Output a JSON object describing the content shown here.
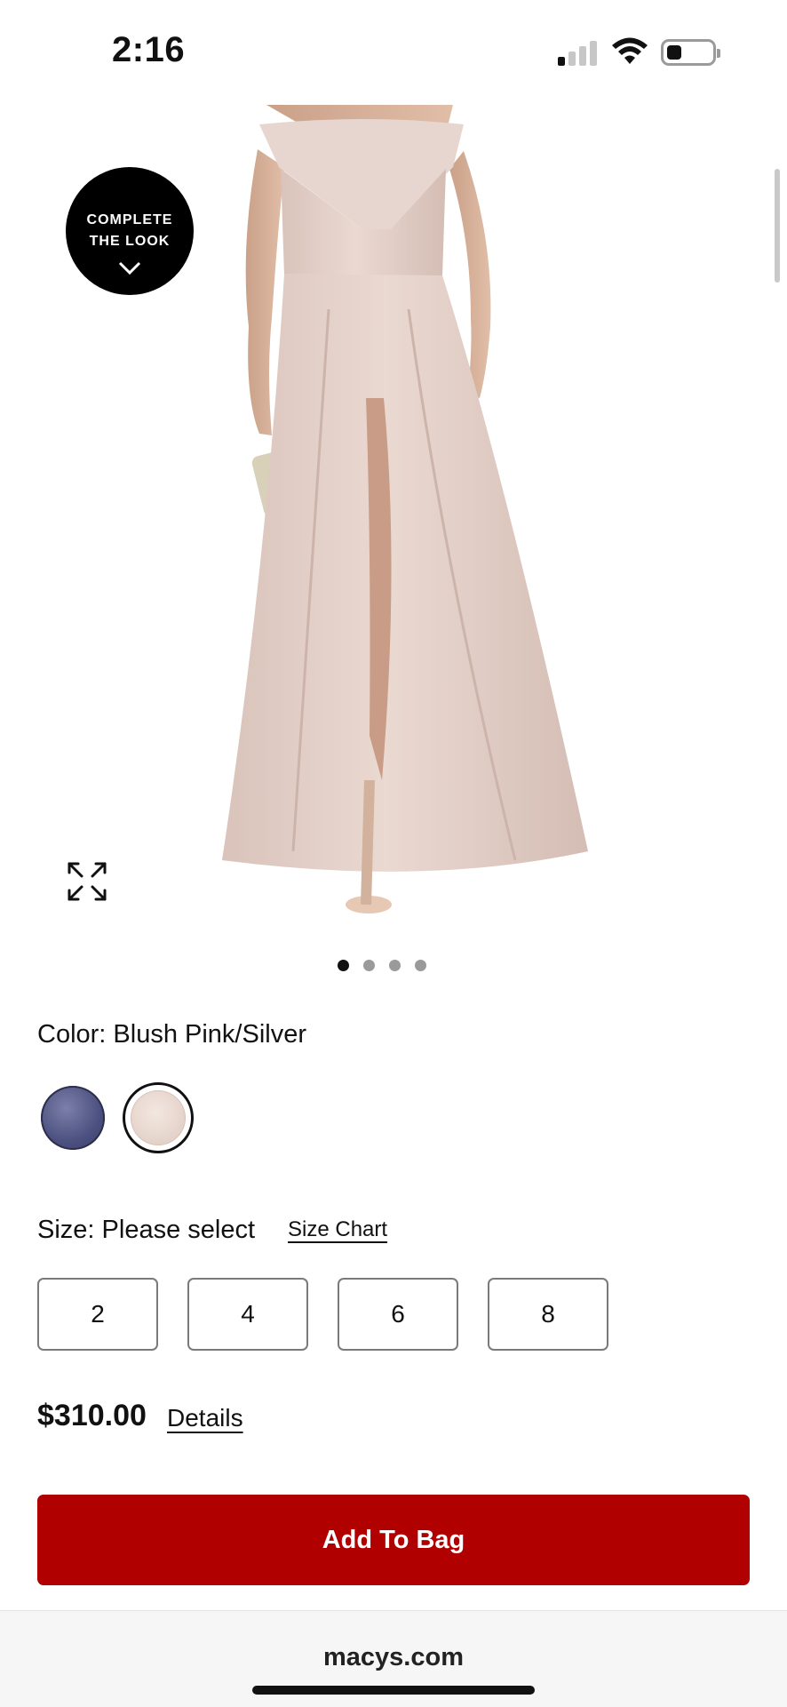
{
  "status_bar": {
    "time": "2:16",
    "signal_bars_active": 1,
    "signal_bars_total": 4,
    "battery_level": 0.2
  },
  "product_image": {
    "complete_the_look": "COMPLETE\nTHE LOOK",
    "image_count": 4,
    "active_index": 0
  },
  "color": {
    "label": "Color: Blush Pink/Silver",
    "swatches": [
      "navy",
      "blush-pink-silver"
    ],
    "selected": "blush-pink-silver"
  },
  "size": {
    "label": "Size: Please select",
    "chart_link": "Size Chart",
    "options": [
      "2",
      "4",
      "6",
      "8"
    ]
  },
  "price": {
    "amount": "$310.00",
    "details_link": "Details"
  },
  "cta": {
    "add_to_bag": "Add To Bag"
  },
  "browser": {
    "domain": "macys.com"
  },
  "colors": {
    "accent_red": "#b00000",
    "text": "#111111"
  }
}
